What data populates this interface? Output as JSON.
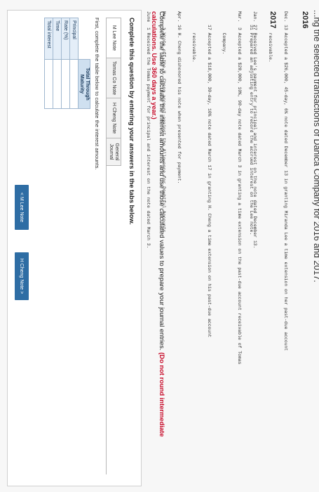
{
  "title": "...ng the selected transactions of Danica Company for 2016 and 2017.",
  "y2016": {
    "year": "2016",
    "entries": [
      "Dec. 13 Accepted a $26,000, 45-day, 6% note dated December 13 in granting Miranda Lee a time extension on her past-due account",
      "        receivable.",
      "     31 Prepared an adjusting entry to record the accrued interest on the Lee note."
    ]
  },
  "y2017": {
    "year": "2017",
    "entries": [
      "Jan. 27 Received Lee's payment for principal and interest on the note dated December 13.",
      "Mar.  3 Accepted a $20,000, 10%, 90-day note dated March 3 in granting a time extension on the past-due account receivable of Tomas",
      "        Company.",
      "     17 Accepted a $18,000, 30-day, 10% note dated March 17 in granting H. Cheng a time extension on his past-due account",
      "        receivable.",
      "Apr. 16 H. Cheng dishonored his note when presented for payment.",
      "May   1 Wrote off the H. Cheng account against the Allowance for Doubtful Accounts.",
      "June  1 Received the Tomas payment for principal and interest on the note dated March 3."
    ]
  },
  "instruction": {
    "text": "Complete the table to calculate the interest amounts and use those calculated values to prepare your journal entries. ",
    "red": "(Do not round intermediate calculations. Use 360 days a year.)"
  },
  "panel": {
    "heading": "Complete this question by entering your answers in the tabs below.",
    "tabs": [
      "M Lee Note",
      "Tomas Co Note",
      "H Cheng Note",
      "General Journal"
    ],
    "first_line": "First, complete the table below to calculate the interest amounts.",
    "table": {
      "header": "Total Through Maturity",
      "rows": [
        "Principal",
        "Rate (%)",
        "Time",
        "Total interest"
      ]
    },
    "prev_button": "< M Lee Note",
    "next_button": "H Cheng Note >"
  }
}
